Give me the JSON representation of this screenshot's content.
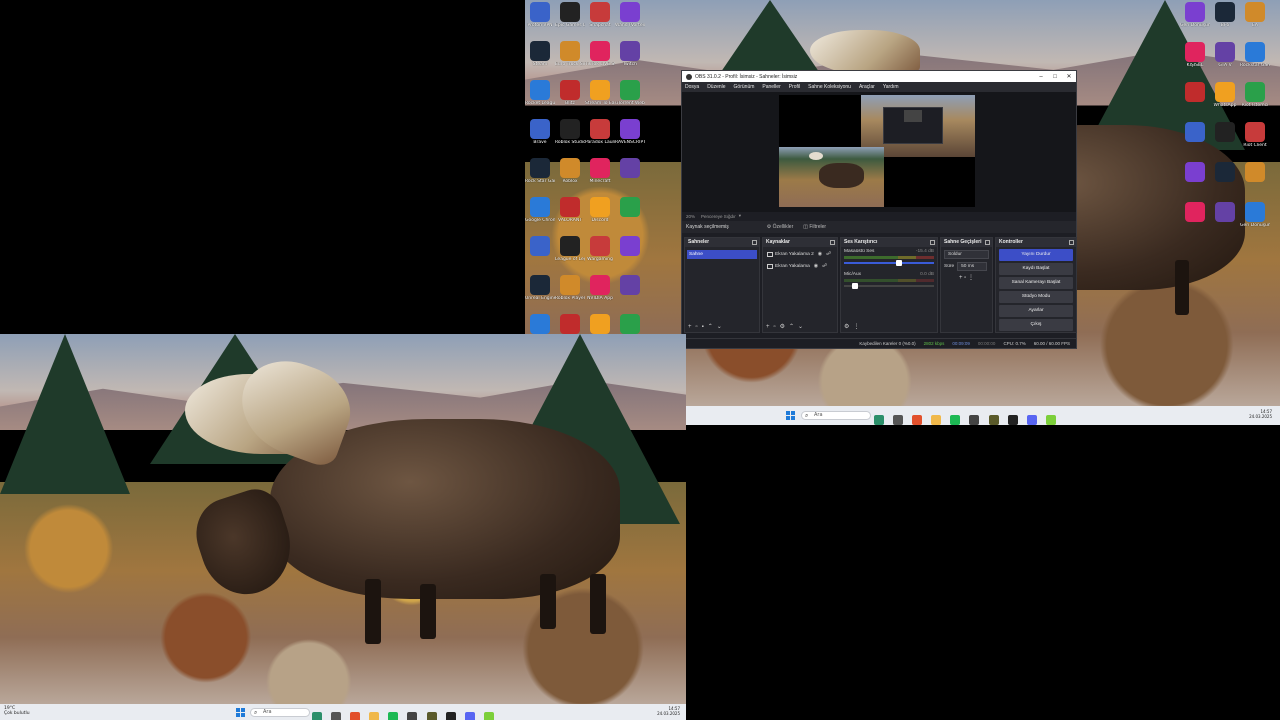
{
  "obs": {
    "title": "OBS 31.0.2 - Profil: İsimsiz - Sahneler: İsimsiz",
    "menu": [
      "Dosya",
      "Düzenle",
      "Görünüm",
      "Paneller",
      "Profil",
      "Sahne Koleksiyonu",
      "Araçlar",
      "Yardım"
    ],
    "zoom": "20%",
    "fit_dropdown": "Pencereye Sığdır",
    "no_source": "Kaynak seçilmemiş",
    "tab_properties": "Özellikler",
    "tab_filters": "Filtreler",
    "docks": {
      "scenes": {
        "title": "Sahneler",
        "items": [
          "Sahne"
        ]
      },
      "sources": {
        "title": "Kaynaklar",
        "items": [
          "Ekran Yakalama 2",
          "Ekran Yakalama"
        ]
      },
      "mixer": {
        "title": "Ses Karıştırıcı",
        "tracks": [
          {
            "name": "Masaüstü Ses",
            "db": "-15.4 dB"
          },
          {
            "name": "Mic/Aux",
            "db": "0.0 dB"
          }
        ]
      },
      "transitions": {
        "title": "Sahne Geçişleri",
        "type": "Soldur",
        "duration_label": "Süre",
        "duration": "50 ms"
      },
      "controls": {
        "title": "Kontroller",
        "buttons": [
          "Yayını Durdur",
          "Kaydı Başlat",
          "Sanal Kamerayı Başlat",
          "Stüdyo Modu",
          "Ayarlar",
          "Çıkış"
        ]
      }
    },
    "status": {
      "dropped": "Kaybedilen Kareler 0 (%0.0)",
      "bitrate": "2802 kbps",
      "stream_time": "00:09:09",
      "rec_time": "00:00:00",
      "cpu": "CPU: 0.7%",
      "fps": "60.00 / 60.00 FPS"
    }
  },
  "taskbar_top": {
    "search": "Ara",
    "time": "14:57",
    "date": "24.03.2025"
  },
  "taskbar_bottom": {
    "search": "Ara",
    "weather_temp": "19°C",
    "weather_text": "Çok bulutlu",
    "time": "14:57",
    "date": "24.03.2025"
  },
  "desktop_icons_left": [
    "Proton VPN",
    "Epic Games Launcher",
    "Snapchat",
    "Wand (Vortex)",
    "Steam",
    "Euro Truck Simulator 2",
    "TikTok LIVE Studio",
    "Twitch",
    "Rocket League",
    "Blitz",
    "Stream To Earn",
    "uTorrent Web",
    "Brave",
    "Roblox Studio",
    "Paradox Launcher",
    "RAVENSCRIPT SIMULATOR",
    "Rock Star Games",
    "Roblox",
    "Minecraft",
    "",
    "Google Chrome",
    "VALORANT",
    "Discord",
    "",
    "",
    "League of Legends",
    "Wargaming",
    "",
    "Unreal Engine",
    "Roblox Player",
    "NVIDIA App",
    "",
    "",
    "",
    "",
    ""
  ],
  "desktop_icons_right": [
    "Geri Dönüşüm",
    "BF6",
    "EA",
    "KİŞİSEL",
    "GTA V",
    "Rockstar Games",
    "",
    "WhatsApp",
    "Riot Istemci",
    "",
    "",
    "Riot Client",
    "",
    "",
    "",
    "",
    "",
    "Geri Dönüşüm Kutusu"
  ],
  "colors": {
    "obs_bg": "#1d1e24",
    "obs_accent": "#3c4ec7",
    "taskbar": "#e9ecf1"
  }
}
